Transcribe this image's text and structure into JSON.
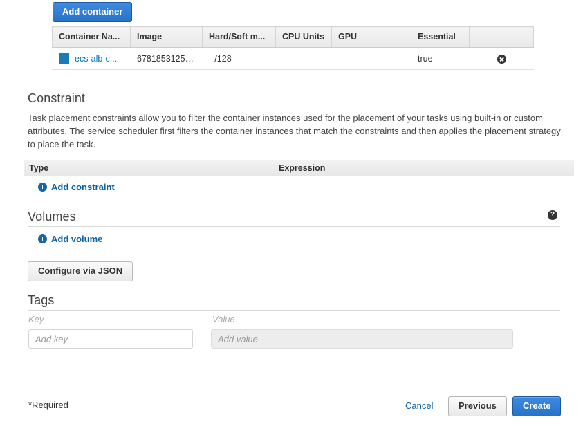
{
  "toolbar": {
    "add_container_label": "Add container"
  },
  "container_table": {
    "columns": [
      "Container Na...",
      "Image",
      "Hard/Soft m...",
      "CPU Units",
      "GPU",
      "Essential",
      ""
    ],
    "rows": [
      {
        "swatch_color": "#1a7bb9",
        "name": "ecs-alb-c...",
        "image": "67818531256...",
        "memory": "--/128",
        "cpu_units": "",
        "gpu": "",
        "essential": "true",
        "remove_icon": "remove-circle-icon"
      }
    ]
  },
  "constraint": {
    "title": "Constraint",
    "description": "Task placement constraints allow you to filter the container instances used for the placement of your tasks using built-in or custom attributes. The service scheduler first filters the container instances that match the constraints and then applies the placement strategy to place the task.",
    "header_type": "Type",
    "header_expression": "Expression",
    "add_label": "Add constraint",
    "add_icon": "plus-circle-icon"
  },
  "volumes": {
    "title": "Volumes",
    "help_icon": "help-circle-icon",
    "help_glyph": "?",
    "add_label": "Add volume",
    "add_icon": "plus-circle-icon"
  },
  "json_config": {
    "label": "Configure via JSON"
  },
  "tags": {
    "title": "Tags",
    "key_label": "Key",
    "value_label": "Value",
    "key_placeholder": "Add key",
    "value_placeholder": "Add value",
    "key_value": "",
    "value_value": ""
  },
  "footer": {
    "required_note": "*Required",
    "cancel_label": "Cancel",
    "previous_label": "Previous",
    "create_label": "Create"
  },
  "colors": {
    "accent_blue": "#0073bb",
    "link_blue": "#0a63a8",
    "primary_button": "#2574c8",
    "swatch": "#1a7bb9"
  }
}
